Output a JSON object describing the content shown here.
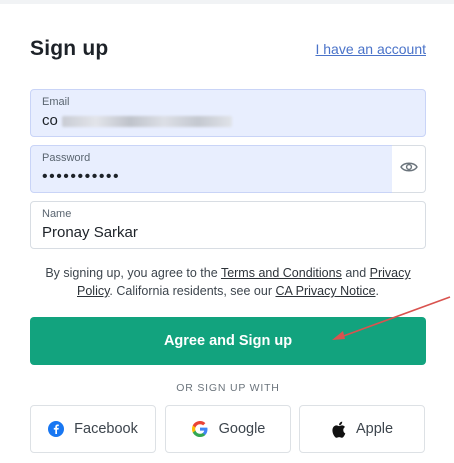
{
  "header": {
    "title": "Sign up",
    "have_account_link": "I have an account"
  },
  "form": {
    "email": {
      "label": "Email",
      "visible_prefix": "co"
    },
    "password": {
      "label": "Password",
      "masked_value": "•••••••••••"
    },
    "name": {
      "label": "Name",
      "value": "Pronay Sarkar"
    }
  },
  "terms": {
    "prefix": "By signing up, you agree to the ",
    "terms_link": "Terms and Conditions",
    "and": " and ",
    "privacy_link": "Privacy Policy",
    "middle": ". California residents, see our ",
    "ca_link": "CA Privacy Notice",
    "suffix": "."
  },
  "signup_button": "Agree and Sign up",
  "social": {
    "divider_text": "OR SIGN UP WITH",
    "buttons": [
      {
        "label": "Facebook",
        "icon": "facebook-icon"
      },
      {
        "label": "Google",
        "icon": "google-icon"
      },
      {
        "label": "Apple",
        "icon": "apple-icon"
      }
    ]
  },
  "colors": {
    "primary_button": "#12a37e",
    "link": "#4a73c9",
    "autofill_bg": "#e8eefe",
    "annotation_arrow": "#d9534f"
  }
}
